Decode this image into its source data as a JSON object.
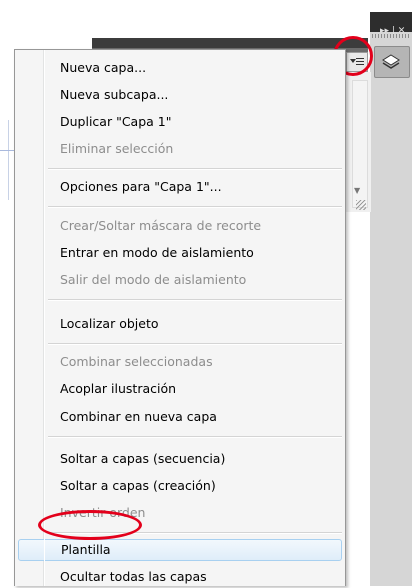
{
  "panel": {
    "dock_controls": "▸▸ | ✕",
    "menu_button_icon": "panel-menu-icon",
    "layers_icon": "layers-icon"
  },
  "menu": {
    "items": [
      {
        "label": "Nueva capa...",
        "enabled": true
      },
      {
        "label": "Nueva subcapa...",
        "enabled": true
      },
      {
        "label": "Duplicar \"Capa 1\"",
        "enabled": true
      },
      {
        "label": "Eliminar selección",
        "enabled": false
      },
      {
        "label": "Opciones para \"Capa 1\"...",
        "enabled": true
      },
      {
        "label": "Crear/Soltar máscara de recorte",
        "enabled": false
      },
      {
        "label": "Entrar en modo de aislamiento",
        "enabled": true
      },
      {
        "label": "Salir del modo de aislamiento",
        "enabled": false
      },
      {
        "label": "Localizar objeto",
        "enabled": true
      },
      {
        "label": "Combinar seleccionadas",
        "enabled": false
      },
      {
        "label": "Acoplar ilustración",
        "enabled": true
      },
      {
        "label": "Combinar en nueva capa",
        "enabled": true
      },
      {
        "label": "Soltar a capas (secuencia)",
        "enabled": true
      },
      {
        "label": "Soltar a capas (creación)",
        "enabled": true
      },
      {
        "label": "Invertir orden",
        "enabled": false
      },
      {
        "label": "Plantilla",
        "enabled": true,
        "highlighted": true
      },
      {
        "label": "Ocultar todas las capas",
        "enabled": true
      }
    ]
  },
  "colors": {
    "highlight_circle": "#e3001b",
    "selection_bg": "#dfedf9",
    "disabled_text": "#8d8d8d"
  }
}
